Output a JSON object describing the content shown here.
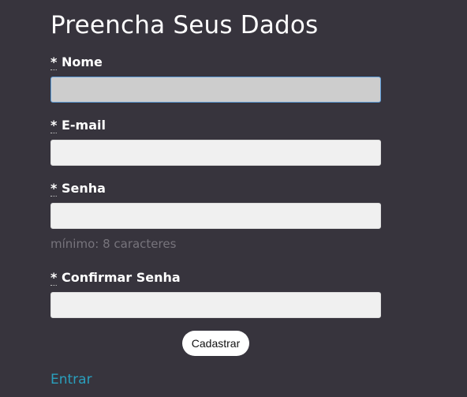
{
  "form": {
    "title": "Preencha Seus Dados",
    "required_marker": "*",
    "fields": [
      {
        "label": "Nome",
        "value": "",
        "placeholder": ""
      },
      {
        "label": "E-mail",
        "value": "",
        "placeholder": ""
      },
      {
        "label": "Senha",
        "value": "",
        "placeholder": ""
      },
      {
        "label": "Confirmar Senha",
        "value": "",
        "placeholder": ""
      }
    ],
    "password_hint": "mínimo: 8 caracteres",
    "submit_label": "Cadastrar",
    "login_link": "Entrar"
  },
  "colors": {
    "background": "#37343d",
    "input_background": "#f0f0f0",
    "focused_input_background": "#cdcdcd",
    "focus_border": "#5d9bd6",
    "hint_text": "#77747c",
    "link": "#2a9fbd"
  }
}
